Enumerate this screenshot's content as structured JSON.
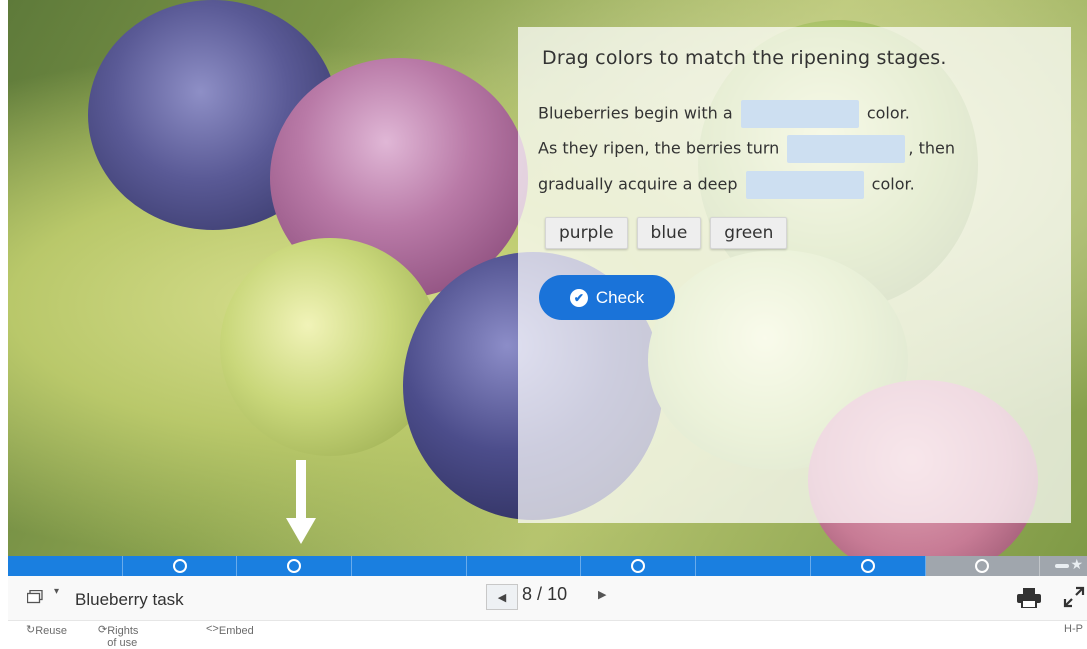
{
  "task": {
    "question": "Drag colors to match the ripening stages.",
    "line1": {
      "before": "Blueberries begin with a",
      "after": "color."
    },
    "line2": {
      "before": "As they ripen, the berries turn",
      "after": ", then"
    },
    "line3": {
      "before": "gradually acquire a deep",
      "after": "color."
    },
    "draggables": [
      "purple",
      "blue",
      "green"
    ],
    "check_label": "Check"
  },
  "progress": {
    "current_slide": 8,
    "total_slides": 10
  },
  "footer": {
    "title": "Blueberry task",
    "page_current": "8",
    "page_sep": "/",
    "page_total": "10",
    "reuse": "Reuse",
    "rights": "Rights of use",
    "embed": "Embed",
    "brand": "H-P"
  },
  "colors": {
    "accent": "#1a73d9",
    "progress_blue": "#1a7fe0",
    "progress_grey": "#a0a6ad"
  },
  "icons": [
    "slides-icon",
    "caret-icon",
    "prev-arrow-icon",
    "next-arrow-icon",
    "print-icon",
    "fullscreen-icon",
    "down-arrow-icon",
    "check-circle-icon"
  ]
}
